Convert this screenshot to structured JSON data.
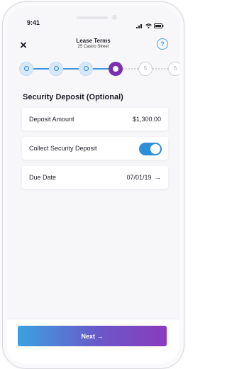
{
  "status": {
    "time": "9:41"
  },
  "header": {
    "title": "Lease Terms",
    "subtitle": "25 Castro Street",
    "close_icon": "×",
    "help_icon": "?"
  },
  "stepper": {
    "steps": [
      "",
      "",
      "",
      "",
      "5",
      "6"
    ],
    "current_step": 4,
    "total_visible_steps": 6
  },
  "section": {
    "title": "Security Deposit (Optional)"
  },
  "fields": {
    "deposit_amount": {
      "label": "Deposit Amount",
      "value": "$1,300.00"
    },
    "collect_deposit": {
      "label": "Collect Security Deposit",
      "enabled": true
    },
    "due_date": {
      "label": "Due Date",
      "value": "07/01/19",
      "arrow": "→"
    }
  },
  "footer": {
    "next_label": "Next →"
  },
  "colors": {
    "accent_blue": "#2c8fd8",
    "accent_purple": "#7b2fb0"
  }
}
